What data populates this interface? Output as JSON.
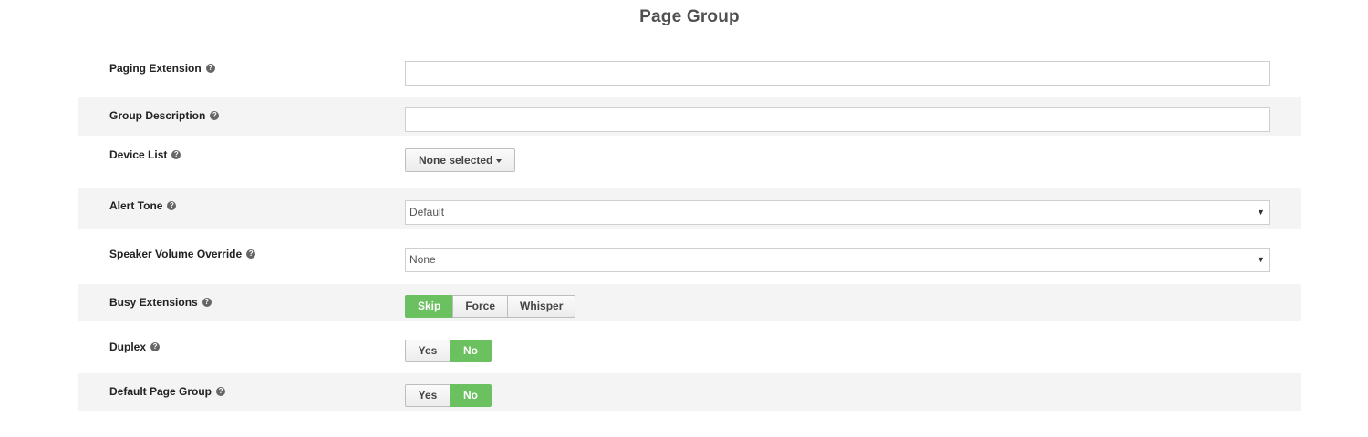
{
  "page": {
    "title": "Page Group"
  },
  "help_glyph": "?",
  "fields": {
    "paging_extension": {
      "label": "Paging Extension",
      "value": "",
      "placeholder": ""
    },
    "group_description": {
      "label": "Group Description",
      "value": "",
      "placeholder": ""
    },
    "device_list": {
      "label": "Device List",
      "button_label": "None selected"
    },
    "alert_tone": {
      "label": "Alert Tone",
      "selected": "Default"
    },
    "speaker_volume_override": {
      "label": "Speaker Volume Override",
      "selected": "None"
    },
    "busy_extensions": {
      "label": "Busy Extensions",
      "options": [
        "Skip",
        "Force",
        "Whisper"
      ],
      "selected": "Skip"
    },
    "duplex": {
      "label": "Duplex",
      "options": [
        "Yes",
        "No"
      ],
      "selected": "No"
    },
    "default_page_group": {
      "label": "Default Page Group",
      "options": [
        "Yes",
        "No"
      ],
      "selected": "No"
    }
  },
  "colors": {
    "active_toggle": "#6bc05f",
    "alt_row": "#f4f4f4",
    "title": "#505050"
  },
  "icons": {
    "help": "question-circle-icon",
    "select_caret": "caret-down-icon"
  }
}
